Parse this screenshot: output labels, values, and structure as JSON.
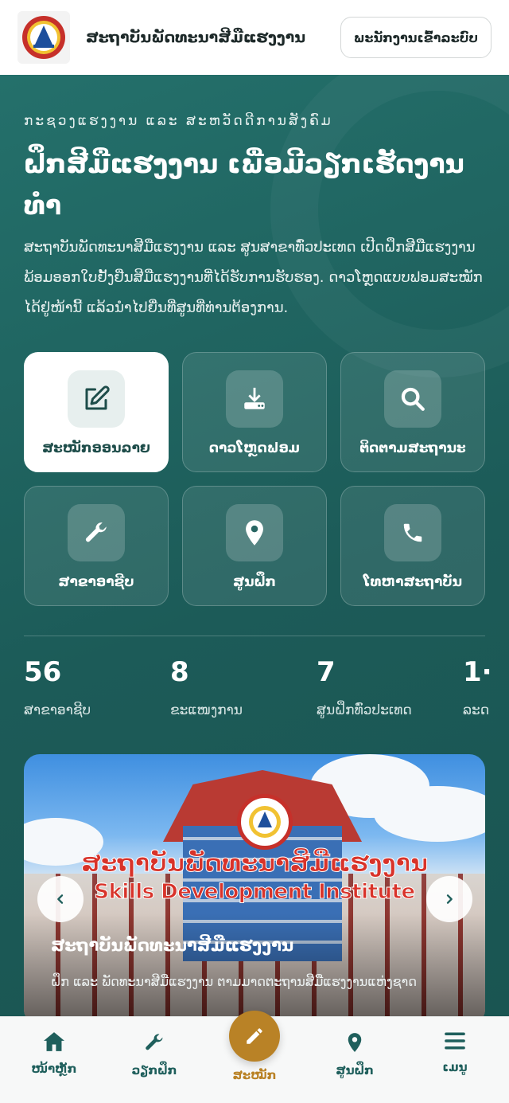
{
  "header": {
    "site_title": "ສະຖາບັນພັດທະນາສີມືແຮງງານ",
    "login_button": "ພະນັກງານເຂົ້າລະບົບ",
    "logo_icon": "institute-gear-logo"
  },
  "hero": {
    "eyebrow": "ກະຊວງແຮງງານ ແລະ ສະຫວັດດີການສັງຄົມ",
    "headline": "ຝຶກສີມືແຮງງານ ເພື່ອມີວຽກເຮັດງານທຳ",
    "intro": "ສະຖາບັນພັດທະນາສີມືແຮງງານ ແລະ ສູນສາຂາທົ່ວປະເທດ ເປີດຝຶກສີມືແຮງງານ ພ້ອມອອກໃບຢັ້ງຢືນສີມືແຮງງານທີ່ໄດ້ຮັບການຮັບຮອງ. ດາວໂຫຼດແບບຟອມສະໝັກໄດ້ຢູ່ໜ້ານີ້ ແລ້ວນຳໄປຍື່ນທີ່ສູນທີ່ທ່ານຕ້ອງການ."
  },
  "actions": [
    {
      "label": "ສະໝັກອອນລາຍ",
      "icon": "edit-icon",
      "active": true
    },
    {
      "label": "ດາວໂຫຼດຟອມ",
      "icon": "download-icon",
      "active": false
    },
    {
      "label": "ຕິດຕາມສະຖານະ",
      "icon": "search-icon",
      "active": false
    },
    {
      "label": "ສາຂາອາຊີບ",
      "icon": "wrench-icon",
      "active": false
    },
    {
      "label": "ສູນຝຶກ",
      "icon": "location-pin-icon",
      "active": false
    },
    {
      "label": "ໂທຫາສະຖາບັນ",
      "icon": "phone-icon",
      "active": false
    }
  ],
  "stats": [
    {
      "value": "56",
      "label": "ສາຂາອາຊີບ"
    },
    {
      "value": "8",
      "label": "ຂະແໜງການ"
    },
    {
      "value": "7",
      "label": "ສູນຝຶກທົ່ວປະເທດ"
    },
    {
      "value": "1·",
      "label": "ລະດ"
    }
  ],
  "banner": {
    "sign_lao": "ສະຖາບັນພັດທະນາສີມືແຮງງານ",
    "sign_en": "Skills Development Institute",
    "title": "ສະຖາບັນພັດທະນາສີມືແຮງງານ",
    "subtitle": "ຝຶກ ແລະ ພັດທະນາສີມືແຮງງານ ຕາມມາດຕະຖານສີມືແຮງງານແຫ່ງຊາດ",
    "prev_icon": "chevron-left-icon",
    "next_icon": "chevron-right-icon"
  },
  "bottom_nav": {
    "items": [
      {
        "label": "ໜ້າຫຼັກ",
        "icon": "home-icon"
      },
      {
        "label": "ວຽກຝຶກ",
        "icon": "wrench-icon"
      },
      {
        "label": "ສະໝັກ",
        "icon": "edit-icon"
      },
      {
        "label": "ສູນຝຶກ",
        "icon": "location-pin-icon"
      },
      {
        "label": "ເມນູ",
        "icon": "menu-icon"
      }
    ]
  },
  "colors": {
    "brand_teal": "#1f5f5c",
    "accent_gold": "#b98226",
    "logo_red": "#c6302a"
  }
}
